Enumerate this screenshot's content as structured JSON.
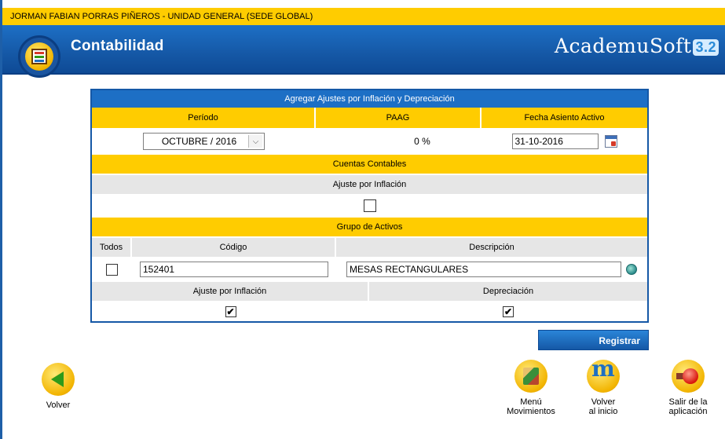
{
  "user_bar": {
    "text": "JORMAN FABIAN PORRAS PIÑEROS - UNIDAD GENERAL (SEDE GLOBAL)"
  },
  "header": {
    "module_title": "Contabilidad",
    "logo_text": "AcademuSoft",
    "logo_version": "3.2"
  },
  "form": {
    "title": "Agregar Ajustes por Inflación y Depreciación",
    "periodo_label": "Período",
    "paag_label": "PAAG",
    "fecha_label": "Fecha Asiento Activo",
    "periodo_value": "OCTUBRE / 2016",
    "paag_value": "0 %",
    "fecha_value": "31-10-2016",
    "cuentas_label": "Cuentas Contables",
    "ajuste_label": "Ajuste por Inflación",
    "ajuste_checked": false,
    "grupo_label": "Grupo de Activos",
    "todos_label": "Todos",
    "codigo_label": "Código",
    "descripcion_label": "Descripción",
    "todos_checked": false,
    "codigo_value": "152401",
    "descripcion_value": "MESAS RECTANGULARES",
    "ajuste_inflacion_label": "Ajuste por Inflación",
    "depreciacion_label": "Depreciación",
    "ajuste_inflacion_checked": true,
    "depreciacion_checked": true,
    "check_mark": "✔"
  },
  "buttons": {
    "registrar": "Registrar",
    "volver": "Volver",
    "menu_line1": "Menú",
    "menu_line2": "Movimientos",
    "home_line1": "Volver",
    "home_line2": "al inicio",
    "exit_line1": "Salir de la",
    "exit_line2": "aplicación"
  },
  "colors": {
    "accent_blue": "#1d6fc5",
    "gold": "#ffcc00",
    "gray_row": "#e6e6e6"
  },
  "icons": [
    "abacus-icon",
    "calendar-icon",
    "search-icon",
    "back-arrow-icon",
    "menu-cube-icon",
    "home-m-icon",
    "exit-icon"
  ]
}
